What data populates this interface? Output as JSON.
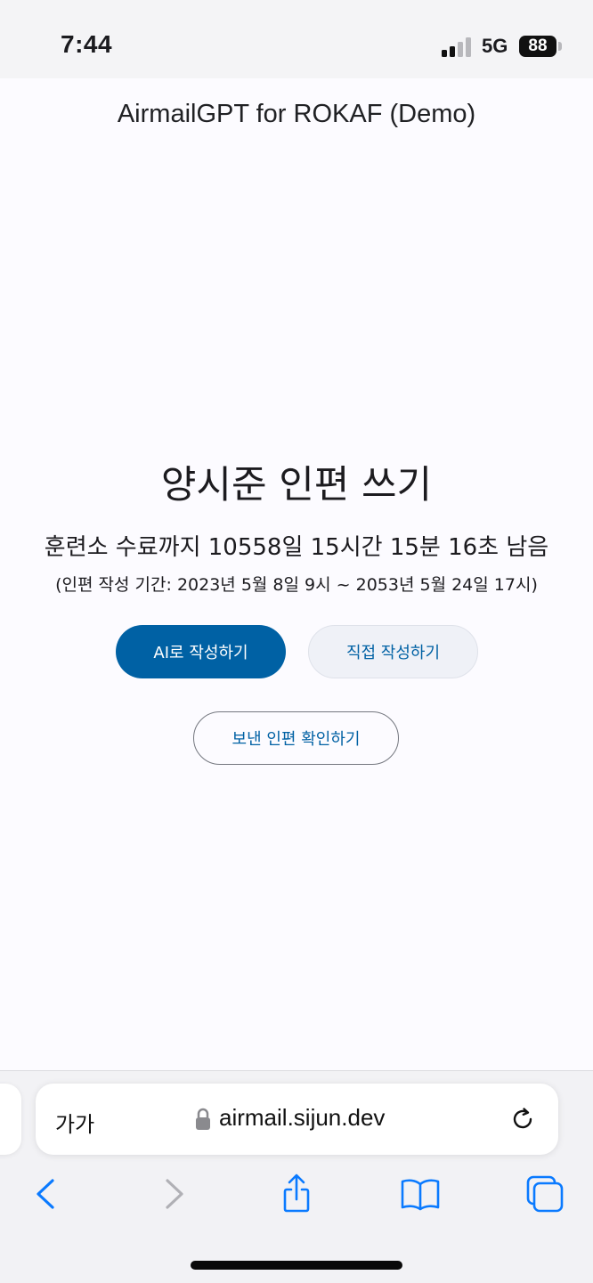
{
  "status_bar": {
    "time": "7:44",
    "network": "5G",
    "battery": "88"
  },
  "page": {
    "title": "AirmailGPT for ROKAF (Demo)",
    "heading": "양시준 인편 쓰기",
    "countdown": "훈련소 수료까지 10558일 15시간 15분 16초 남음",
    "period": "(인편 작성 기간: 2023년 5월 8일 9시 ~ 2053년 5월 24일 17시)",
    "buttons": {
      "ai_write": "AI로 작성하기",
      "manual_write": "직접 작성하기",
      "view_sent": "보낸 인편 확인하기"
    }
  },
  "browser": {
    "text_size_label": "가가",
    "url": "airmail.sijun.dev",
    "toolbar": [
      "back-icon",
      "forward-icon",
      "share-icon",
      "bookmarks-icon",
      "tabs-icon"
    ]
  },
  "colors": {
    "primary": "#0061a4",
    "background": "#fcfbff",
    "tonal": "#eff1f7"
  }
}
